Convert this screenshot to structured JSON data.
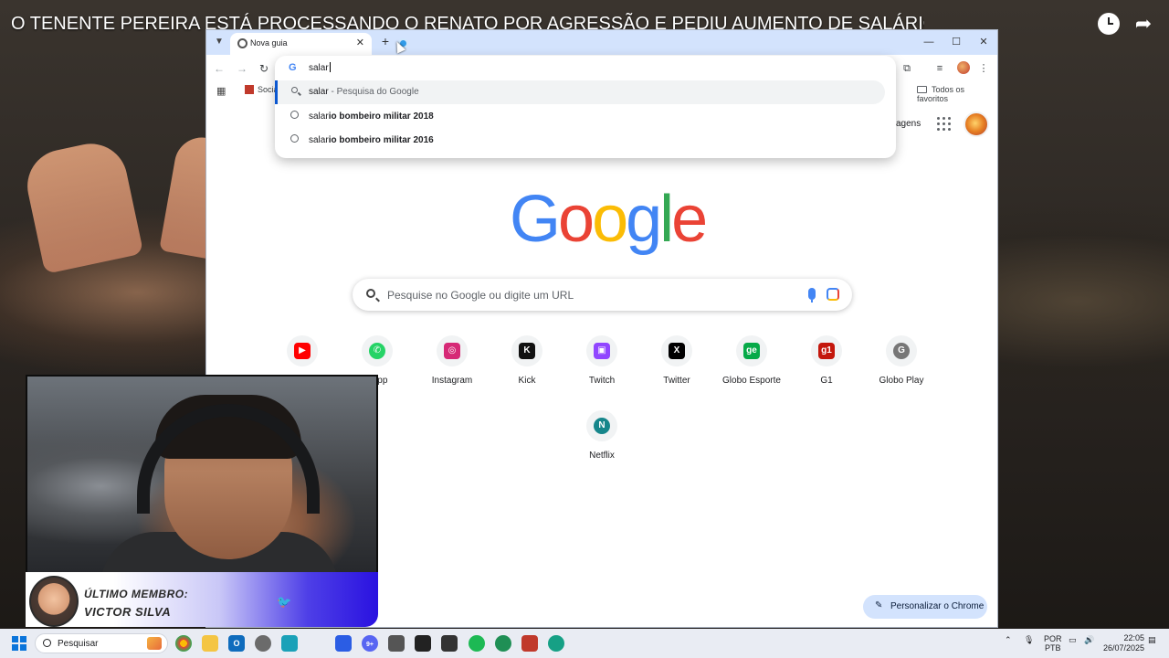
{
  "video": {
    "title": "O TENENTE PEREIRA ESTÁ PROCESSANDO O RENATO POR AGRESSÃO E PEDIU AUMENTO DE SALÁRIO...😱"
  },
  "browser": {
    "tab_title": "Nova guia",
    "bookmark_item": "Socia",
    "all_bookmarks": "Todos os favoritos",
    "omnibox": {
      "typed": "salar",
      "suggestions": [
        {
          "icon": "search-icon",
          "typed": "salar",
          "rest": " - Pesquisa do Google"
        },
        {
          "icon": "history-icon",
          "typed": "salar",
          "rest": "io bombeiro militar 2018"
        },
        {
          "icon": "history-icon",
          "typed": "salar",
          "rest": "io bombeiro militar 2016"
        }
      ]
    },
    "ntp": {
      "images_link": "agens",
      "logo_letters": [
        "G",
        "o",
        "o",
        "g",
        "l",
        "e"
      ],
      "logo_colors": [
        "#4285f4",
        "#ea4335",
        "#fbbc05",
        "#4285f4",
        "#34a853",
        "#ea4335"
      ],
      "search_placeholder": "Pesquise no Google ou digite um URL",
      "shortcuts": [
        {
          "label": "",
          "glyph": "▶",
          "color": "#ff0000"
        },
        {
          "label": "sApp",
          "glyph": "✆",
          "color": "#25d366"
        },
        {
          "label": "Instagram",
          "glyph": "◎",
          "color": "#d62976"
        },
        {
          "label": "Kick",
          "glyph": "K",
          "color": "#111111"
        },
        {
          "label": "Twitch",
          "glyph": "▣",
          "color": "#9146ff"
        },
        {
          "label": "Twitter",
          "glyph": "X",
          "color": "#000000"
        },
        {
          "label": "Globo Esporte",
          "glyph": "ge",
          "color": "#06aa48"
        },
        {
          "label": "G1",
          "glyph": "g1",
          "color": "#c4170c"
        },
        {
          "label": "Globo Play",
          "glyph": "G",
          "color": "#777777"
        },
        {
          "label": "Netflix",
          "glyph": "N",
          "color": "#16868b"
        }
      ],
      "customize_label": "Personalizar o Chrome"
    }
  },
  "overlay": {
    "member_label": "ÚLTIMO MEMBRO:",
    "member_name": "VICTOR SILVA"
  },
  "taskbar": {
    "search_label": "Pesquisar",
    "lang_top": "POR",
    "lang_bottom": "PTB",
    "time": "22:05",
    "date": "26/07/2025",
    "discord_badge": "9+"
  }
}
